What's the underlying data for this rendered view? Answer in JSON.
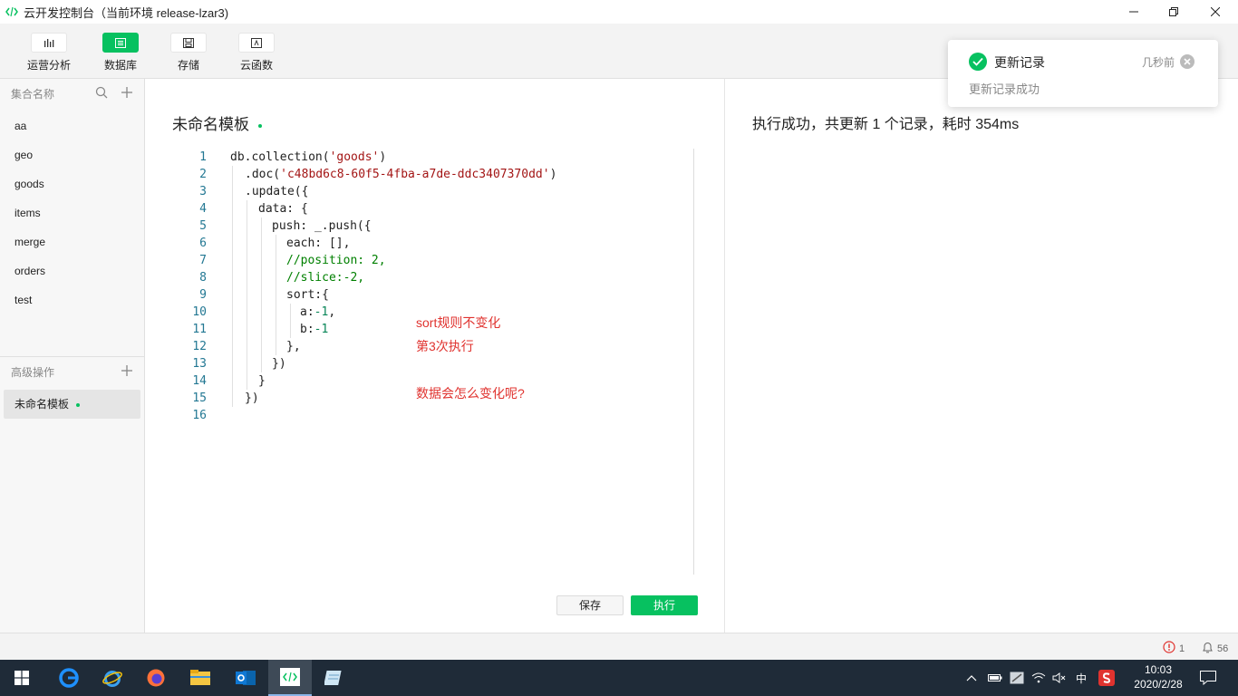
{
  "window": {
    "title": "云开发控制台（当前环境 release-lzar3)"
  },
  "toolbar": {
    "items": [
      {
        "label": "运营分析",
        "icon": "bar-chart-icon"
      },
      {
        "label": "数据库",
        "icon": "database-icon"
      },
      {
        "label": "存储",
        "icon": "storage-icon"
      },
      {
        "label": "云函数",
        "icon": "function-icon"
      }
    ]
  },
  "sidebar": {
    "collections_header": "集合名称",
    "collections": [
      "aa",
      "geo",
      "goods",
      "items",
      "merge",
      "orders",
      "test"
    ],
    "advanced_header": "高级操作",
    "advanced_item": "未命名模板"
  },
  "editor": {
    "title": "未命名模板",
    "lines": [
      "1",
      "2",
      "3",
      "4",
      "5",
      "6",
      "7",
      "8",
      "9",
      "10",
      "11",
      "12",
      "13",
      "14",
      "15",
      "16"
    ],
    "code": {
      "l1_a": "db.collection(",
      "l1_str": "'goods'",
      "l1_b": ")",
      "l2_a": ".doc(",
      "l2_str": "'c48bd6c8-60f5-4fba-a7de-ddc3407370dd'",
      "l2_b": ")",
      "l3": ".update({",
      "l4": "data: {",
      "l5": "push: _.push({",
      "l6": "each: [],",
      "l7": "//position: 2,",
      "l8": "//slice:-2,",
      "l9": "sort:{",
      "l10_a": "a:",
      "l10_num": "-1",
      "l10_b": ",",
      "l11_a": "b:",
      "l11_num": "-1",
      "l12": "},",
      "l13": "})",
      "l14": "}",
      "l15": "})"
    },
    "notes": [
      "sort规则不变化",
      "第3次执行",
      "数据会怎么变化呢?"
    ],
    "save_label": "保存",
    "run_label": "执行"
  },
  "result": {
    "text": "执行成功，共更新 1 个记录，耗时 354ms"
  },
  "toast": {
    "title": "更新记录",
    "time": "几秒前",
    "message": "更新记录成功"
  },
  "statusbar": {
    "errors": "1",
    "notifications": "56"
  },
  "taskbar": {
    "apps": [
      "windows-start-icon",
      "edge-icon",
      "ie-icon",
      "firefox-icon",
      "file-explorer-icon",
      "outlook-icon",
      "devtools-icon",
      "notepad-icon"
    ],
    "ime": "中",
    "time": "10:03",
    "date": "2020/2/28"
  }
}
